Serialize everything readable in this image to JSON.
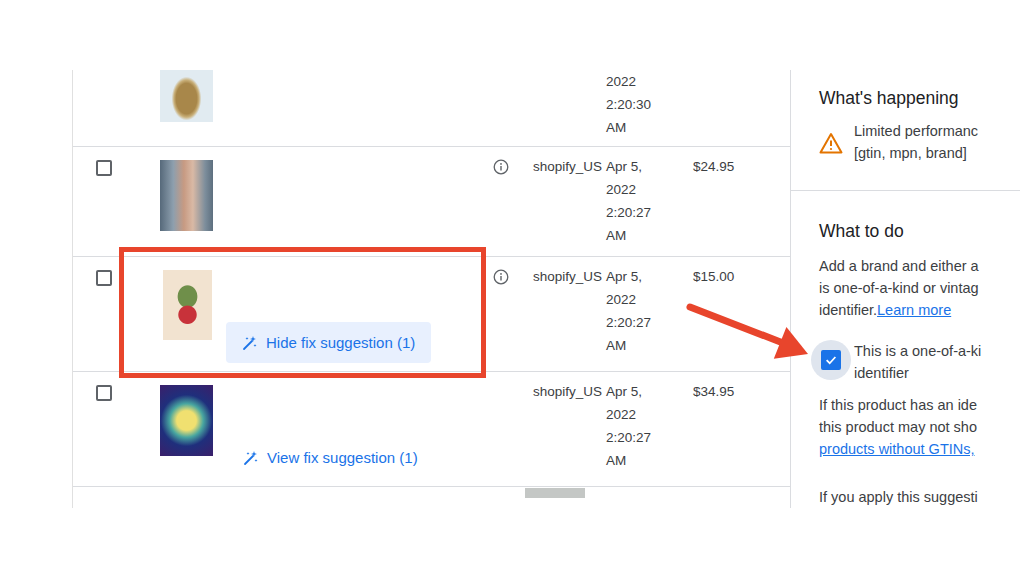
{
  "table": {
    "rows": [
      {
        "kind": "partial",
        "date": [
          "2022",
          "2:20:30",
          "AM"
        ]
      },
      {
        "kind": "full",
        "checked": false,
        "has_info": true,
        "source": "shopify_US",
        "date": [
          "Apr 5,",
          "2022",
          "2:20:27",
          "AM"
        ],
        "price": "$24.95",
        "highlighted": false
      },
      {
        "kind": "full",
        "checked": false,
        "has_info": true,
        "source": "shopify_US",
        "date": [
          "Apr 5,",
          "2022",
          "2:20:27",
          "AM"
        ],
        "price": "$15.00",
        "highlighted": true,
        "fix": {
          "label": "Hide fix suggestion (1)",
          "expanded": true
        }
      },
      {
        "kind": "full",
        "checked": false,
        "has_info": false,
        "source": "shopify_US",
        "date": [
          "Apr 5,",
          "2022",
          "2:20:27",
          "AM"
        ],
        "price": "$34.95",
        "highlighted": false,
        "fix": {
          "label": "View fix suggestion (1)",
          "expanded": false
        }
      }
    ],
    "scrollbar": {
      "level": 0.084,
      "offset": 0.63
    }
  },
  "panel": {
    "happening": {
      "title": "What's happening",
      "issue_lines": [
        "Limited performanc",
        "[gtin, mpn, brand]"
      ]
    },
    "todo": {
      "title": "What to do",
      "intro_lines": [
        "Add a brand and either a",
        "is one-of-a-kind or vintag"
      ],
      "intro_last": "identifier.",
      "learn_more": "Learn more",
      "option": {
        "checked": true,
        "label_lines": [
          "This is a one-of-a-ki",
          "identifier"
        ]
      },
      "note_lines": [
        "If this product has an ide",
        "this product may not sho"
      ],
      "note_link": "products without GTINs,",
      "apply_line": "If you apply this suggesti"
    }
  },
  "annotations": {
    "arrow": true
  }
}
